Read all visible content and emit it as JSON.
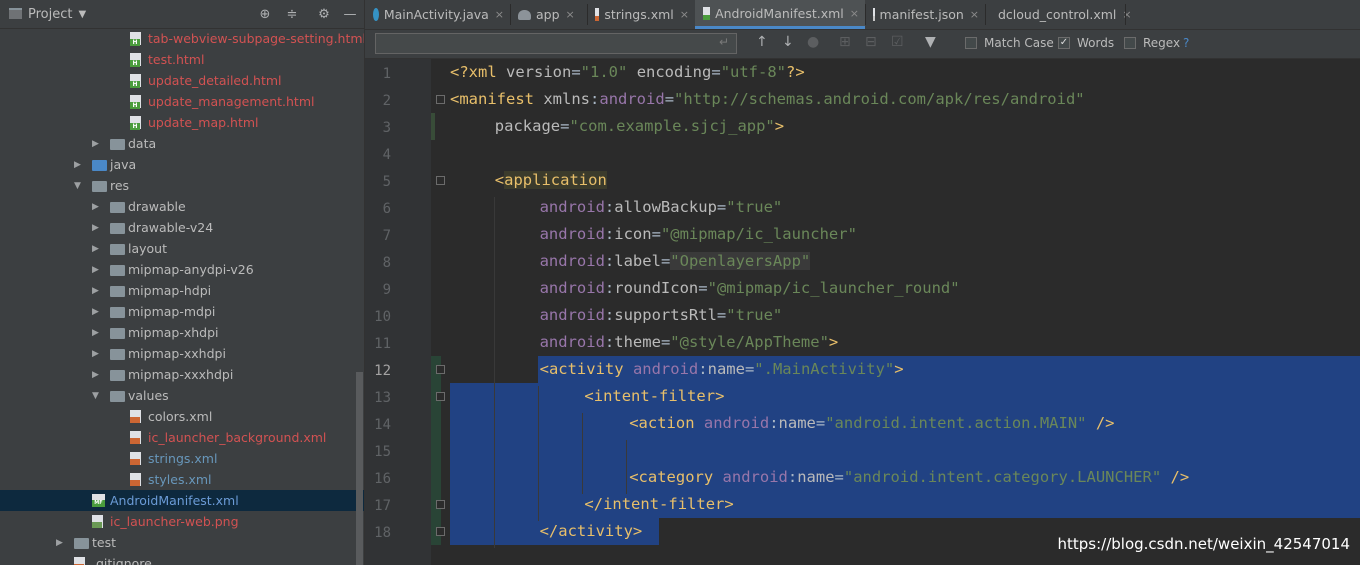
{
  "project_header": {
    "title": "Project"
  },
  "tree": [
    {
      "label": "tab-webview-subpage-setting.html",
      "type": "html",
      "indent": 130,
      "color": "red",
      "arrow": ""
    },
    {
      "label": "test.html",
      "type": "html",
      "indent": 130,
      "color": "red",
      "arrow": ""
    },
    {
      "label": "update_detailed.html",
      "type": "html",
      "indent": 130,
      "color": "red",
      "arrow": ""
    },
    {
      "label": "update_management.html",
      "type": "html",
      "indent": 130,
      "color": "red",
      "arrow": ""
    },
    {
      "label": "update_map.html",
      "type": "html",
      "indent": 130,
      "color": "red",
      "arrow": ""
    },
    {
      "label": "data",
      "type": "folder",
      "indent": 110,
      "color": "def",
      "arrow": "right"
    },
    {
      "label": "java",
      "type": "folder-blue",
      "indent": 92,
      "color": "def",
      "arrow": "right"
    },
    {
      "label": "res",
      "type": "folder",
      "indent": 92,
      "color": "def",
      "arrow": "down"
    },
    {
      "label": "drawable",
      "type": "folder",
      "indent": 110,
      "color": "def",
      "arrow": "right"
    },
    {
      "label": "drawable-v24",
      "type": "folder",
      "indent": 110,
      "color": "def",
      "arrow": "right"
    },
    {
      "label": "layout",
      "type": "folder",
      "indent": 110,
      "color": "def",
      "arrow": "right"
    },
    {
      "label": "mipmap-anydpi-v26",
      "type": "folder",
      "indent": 110,
      "color": "def",
      "arrow": "right"
    },
    {
      "label": "mipmap-hdpi",
      "type": "folder",
      "indent": 110,
      "color": "def",
      "arrow": "right"
    },
    {
      "label": "mipmap-mdpi",
      "type": "folder",
      "indent": 110,
      "color": "def",
      "arrow": "right"
    },
    {
      "label": "mipmap-xhdpi",
      "type": "folder",
      "indent": 110,
      "color": "def",
      "arrow": "right"
    },
    {
      "label": "mipmap-xxhdpi",
      "type": "folder",
      "indent": 110,
      "color": "def",
      "arrow": "right"
    },
    {
      "label": "mipmap-xxxhdpi",
      "type": "folder",
      "indent": 110,
      "color": "def",
      "arrow": "right"
    },
    {
      "label": "values",
      "type": "folder",
      "indent": 110,
      "color": "def",
      "arrow": "down"
    },
    {
      "label": "colors.xml",
      "type": "xml",
      "indent": 130,
      "color": "def",
      "arrow": ""
    },
    {
      "label": "ic_launcher_background.xml",
      "type": "xml",
      "indent": 130,
      "color": "red",
      "arrow": ""
    },
    {
      "label": "strings.xml",
      "type": "xml",
      "indent": 130,
      "color": "blue",
      "arrow": ""
    },
    {
      "label": "styles.xml",
      "type": "xml",
      "indent": 130,
      "color": "blue",
      "arrow": ""
    },
    {
      "label": "AndroidManifest.xml",
      "type": "mf",
      "indent": 92,
      "color": "mf",
      "arrow": "",
      "selected": true
    },
    {
      "label": "ic_launcher-web.png",
      "type": "png",
      "indent": 92,
      "color": "red",
      "arrow": ""
    },
    {
      "label": "test",
      "type": "folder",
      "indent": 74,
      "color": "def",
      "arrow": "right"
    },
    {
      "label": ".gitignore",
      "type": "xml",
      "indent": 74,
      "color": "def",
      "arrow": ""
    }
  ],
  "tabs": [
    {
      "label": "MainActivity.java",
      "icon": "java-class-icon",
      "active": false
    },
    {
      "label": "app",
      "icon": "android-module-icon",
      "active": false
    },
    {
      "label": "strings.xml",
      "icon": "xml-file-icon",
      "active": false
    },
    {
      "label": "AndroidManifest.xml",
      "icon": "manifest-file-icon",
      "active": true
    },
    {
      "label": "manifest.json",
      "icon": "json-file-icon",
      "active": false
    },
    {
      "label": "dcloud_control.xml",
      "icon": "xml-file-icon",
      "active": false
    }
  ],
  "search": {
    "value": "",
    "match_case_label": "Match Case",
    "match_case": false,
    "words_label": "Words",
    "words": true,
    "regex_label": "Regex",
    "regex": false,
    "help": "?"
  },
  "editor": {
    "lines": [
      {
        "n": "1",
        "indent": 0,
        "tokens": [
          [
            "br",
            "<?"
          ],
          [
            "tag",
            "xml "
          ],
          [
            "attr",
            "version"
          ],
          [
            "plain",
            "="
          ],
          [
            "val",
            "\"1.0\""
          ],
          [
            "plain",
            " "
          ],
          [
            "attr",
            "encoding"
          ],
          [
            "plain",
            "="
          ],
          [
            "val",
            "\"utf-8\""
          ],
          [
            "br",
            "?>"
          ]
        ]
      },
      {
        "n": "2",
        "indent": 0,
        "tokens": [
          [
            "br",
            "<"
          ],
          [
            "tag",
            "manifest "
          ],
          [
            "attr",
            "xmlns"
          ],
          [
            "plain",
            ":"
          ],
          [
            "ns",
            "android"
          ],
          [
            "plain",
            "="
          ],
          [
            "val",
            "\"http://schemas.android.com/apk/res/android\""
          ]
        ]
      },
      {
        "n": "3",
        "indent": 4,
        "tokens": [
          [
            "attr",
            "package"
          ],
          [
            "plain",
            "="
          ],
          [
            "val",
            "\"com.example.sjcj_app\""
          ],
          [
            "br",
            ">"
          ]
        ]
      },
      {
        "n": "4",
        "indent": 0,
        "tokens": []
      },
      {
        "n": "5",
        "indent": 4,
        "tokens": [
          [
            "br",
            "<"
          ],
          [
            "tag",
            "application"
          ]
        ]
      },
      {
        "n": "6",
        "indent": 8,
        "tokens": [
          [
            "ns",
            "android"
          ],
          [
            "plain",
            ":"
          ],
          [
            "attr",
            "allowBackup"
          ],
          [
            "plain",
            "="
          ],
          [
            "val",
            "\"true\""
          ]
        ]
      },
      {
        "n": "7",
        "indent": 8,
        "tokens": [
          [
            "ns",
            "android"
          ],
          [
            "plain",
            ":"
          ],
          [
            "attr",
            "icon"
          ],
          [
            "plain",
            "="
          ],
          [
            "val",
            "\"@mipmap/ic_launcher\""
          ]
        ]
      },
      {
        "n": "8",
        "indent": 8,
        "tokens": [
          [
            "ns",
            "android"
          ],
          [
            "plain",
            ":"
          ],
          [
            "attr",
            "label"
          ],
          [
            "plain",
            "="
          ],
          [
            "val",
            "\"OpenlayersApp\""
          ]
        ]
      },
      {
        "n": "9",
        "indent": 8,
        "tokens": [
          [
            "ns",
            "android"
          ],
          [
            "plain",
            ":"
          ],
          [
            "attr",
            "roundIcon"
          ],
          [
            "plain",
            "="
          ],
          [
            "val",
            "\"@mipmap/ic_launcher_round\""
          ]
        ]
      },
      {
        "n": "10",
        "indent": 8,
        "tokens": [
          [
            "ns",
            "android"
          ],
          [
            "plain",
            ":"
          ],
          [
            "attr",
            "supportsRtl"
          ],
          [
            "plain",
            "="
          ],
          [
            "val",
            "\"true\""
          ]
        ]
      },
      {
        "n": "11",
        "indent": 8,
        "tokens": [
          [
            "ns",
            "android"
          ],
          [
            "plain",
            ":"
          ],
          [
            "attr",
            "theme"
          ],
          [
            "plain",
            "="
          ],
          [
            "val",
            "\"@style/AppTheme\""
          ],
          [
            "br",
            ">"
          ]
        ]
      },
      {
        "n": "12",
        "indent": 8,
        "tokens": [
          [
            "br",
            "<"
          ],
          [
            "tag",
            "activity "
          ],
          [
            "ns",
            "android"
          ],
          [
            "plain",
            ":"
          ],
          [
            "attr",
            "name"
          ],
          [
            "plain",
            "="
          ],
          [
            "val",
            "\".MainActivity\""
          ],
          [
            "br",
            ">"
          ]
        ]
      },
      {
        "n": "13",
        "indent": 12,
        "tokens": [
          [
            "br",
            "<"
          ],
          [
            "tag",
            "intent-filter"
          ],
          [
            "br",
            ">"
          ]
        ]
      },
      {
        "n": "14",
        "indent": 16,
        "tokens": [
          [
            "br",
            "<"
          ],
          [
            "tag",
            "action "
          ],
          [
            "ns",
            "android"
          ],
          [
            "plain",
            ":"
          ],
          [
            "attr",
            "name"
          ],
          [
            "plain",
            "="
          ],
          [
            "val",
            "\"android.intent.action.MAIN\""
          ],
          [
            "plain",
            " "
          ],
          [
            "br",
            "/>"
          ]
        ]
      },
      {
        "n": "15",
        "indent": 0,
        "tokens": []
      },
      {
        "n": "16",
        "indent": 16,
        "tokens": [
          [
            "br",
            "<"
          ],
          [
            "tag",
            "category "
          ],
          [
            "ns",
            "android"
          ],
          [
            "plain",
            ":"
          ],
          [
            "attr",
            "name"
          ],
          [
            "plain",
            "="
          ],
          [
            "val",
            "\"android.intent.category.LAUNCHER\""
          ],
          [
            "plain",
            " "
          ],
          [
            "br",
            "/>"
          ]
        ]
      },
      {
        "n": "17",
        "indent": 12,
        "tokens": [
          [
            "br",
            "</"
          ],
          [
            "tag",
            "intent-filter"
          ],
          [
            "br",
            ">"
          ]
        ]
      },
      {
        "n": "18",
        "indent": 8,
        "tokens": [
          [
            "br",
            "</"
          ],
          [
            "tag",
            "activity"
          ],
          [
            "br",
            ">"
          ]
        ]
      }
    ]
  },
  "watermark": "https://blog.csdn.net/weixin_42547014"
}
